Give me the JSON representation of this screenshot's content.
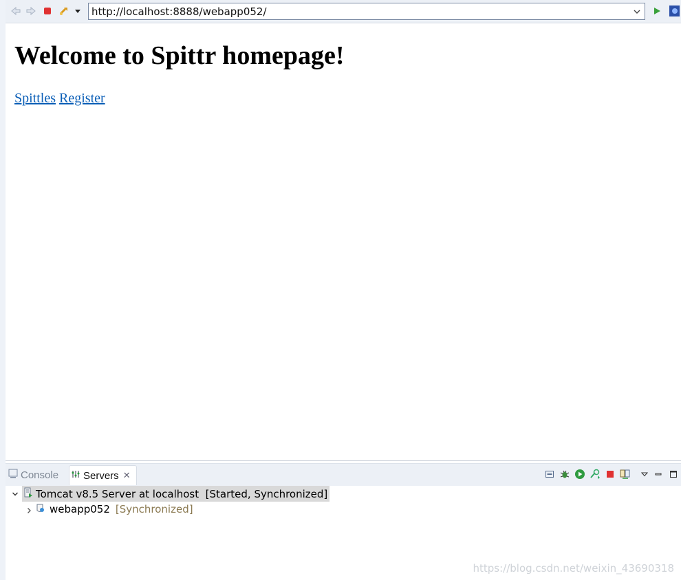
{
  "browser": {
    "url": "http://localhost:8888/webapp052/",
    "icons": [
      "back-icon",
      "forward-icon",
      "stop-icon",
      "refresh-icon",
      "menu-dropdown-icon",
      "url-dropdown-icon",
      "go-icon",
      "external-browser-icon"
    ]
  },
  "page": {
    "title": "Welcome to Spittr homepage!",
    "links": [
      "Spittles",
      "Register"
    ]
  },
  "servers_view": {
    "tabs": [
      {
        "label": "Console",
        "active": false
      },
      {
        "label": "Servers",
        "active": true
      }
    ],
    "tree": [
      {
        "label": "Tomcat v8.5 Server at localhost  [Started, Synchronized]",
        "expanded": true
      },
      {
        "label": "webapp052",
        "status": "[Synchronized]",
        "expanded": false
      }
    ]
  },
  "watermark": "https://blog.csdn.net/weixin_43690318",
  "colors": {
    "link": "#0c5fb7",
    "selection": "#d9d9d9",
    "status": "#8b7a52",
    "toolbar": "#ecf0f6"
  }
}
